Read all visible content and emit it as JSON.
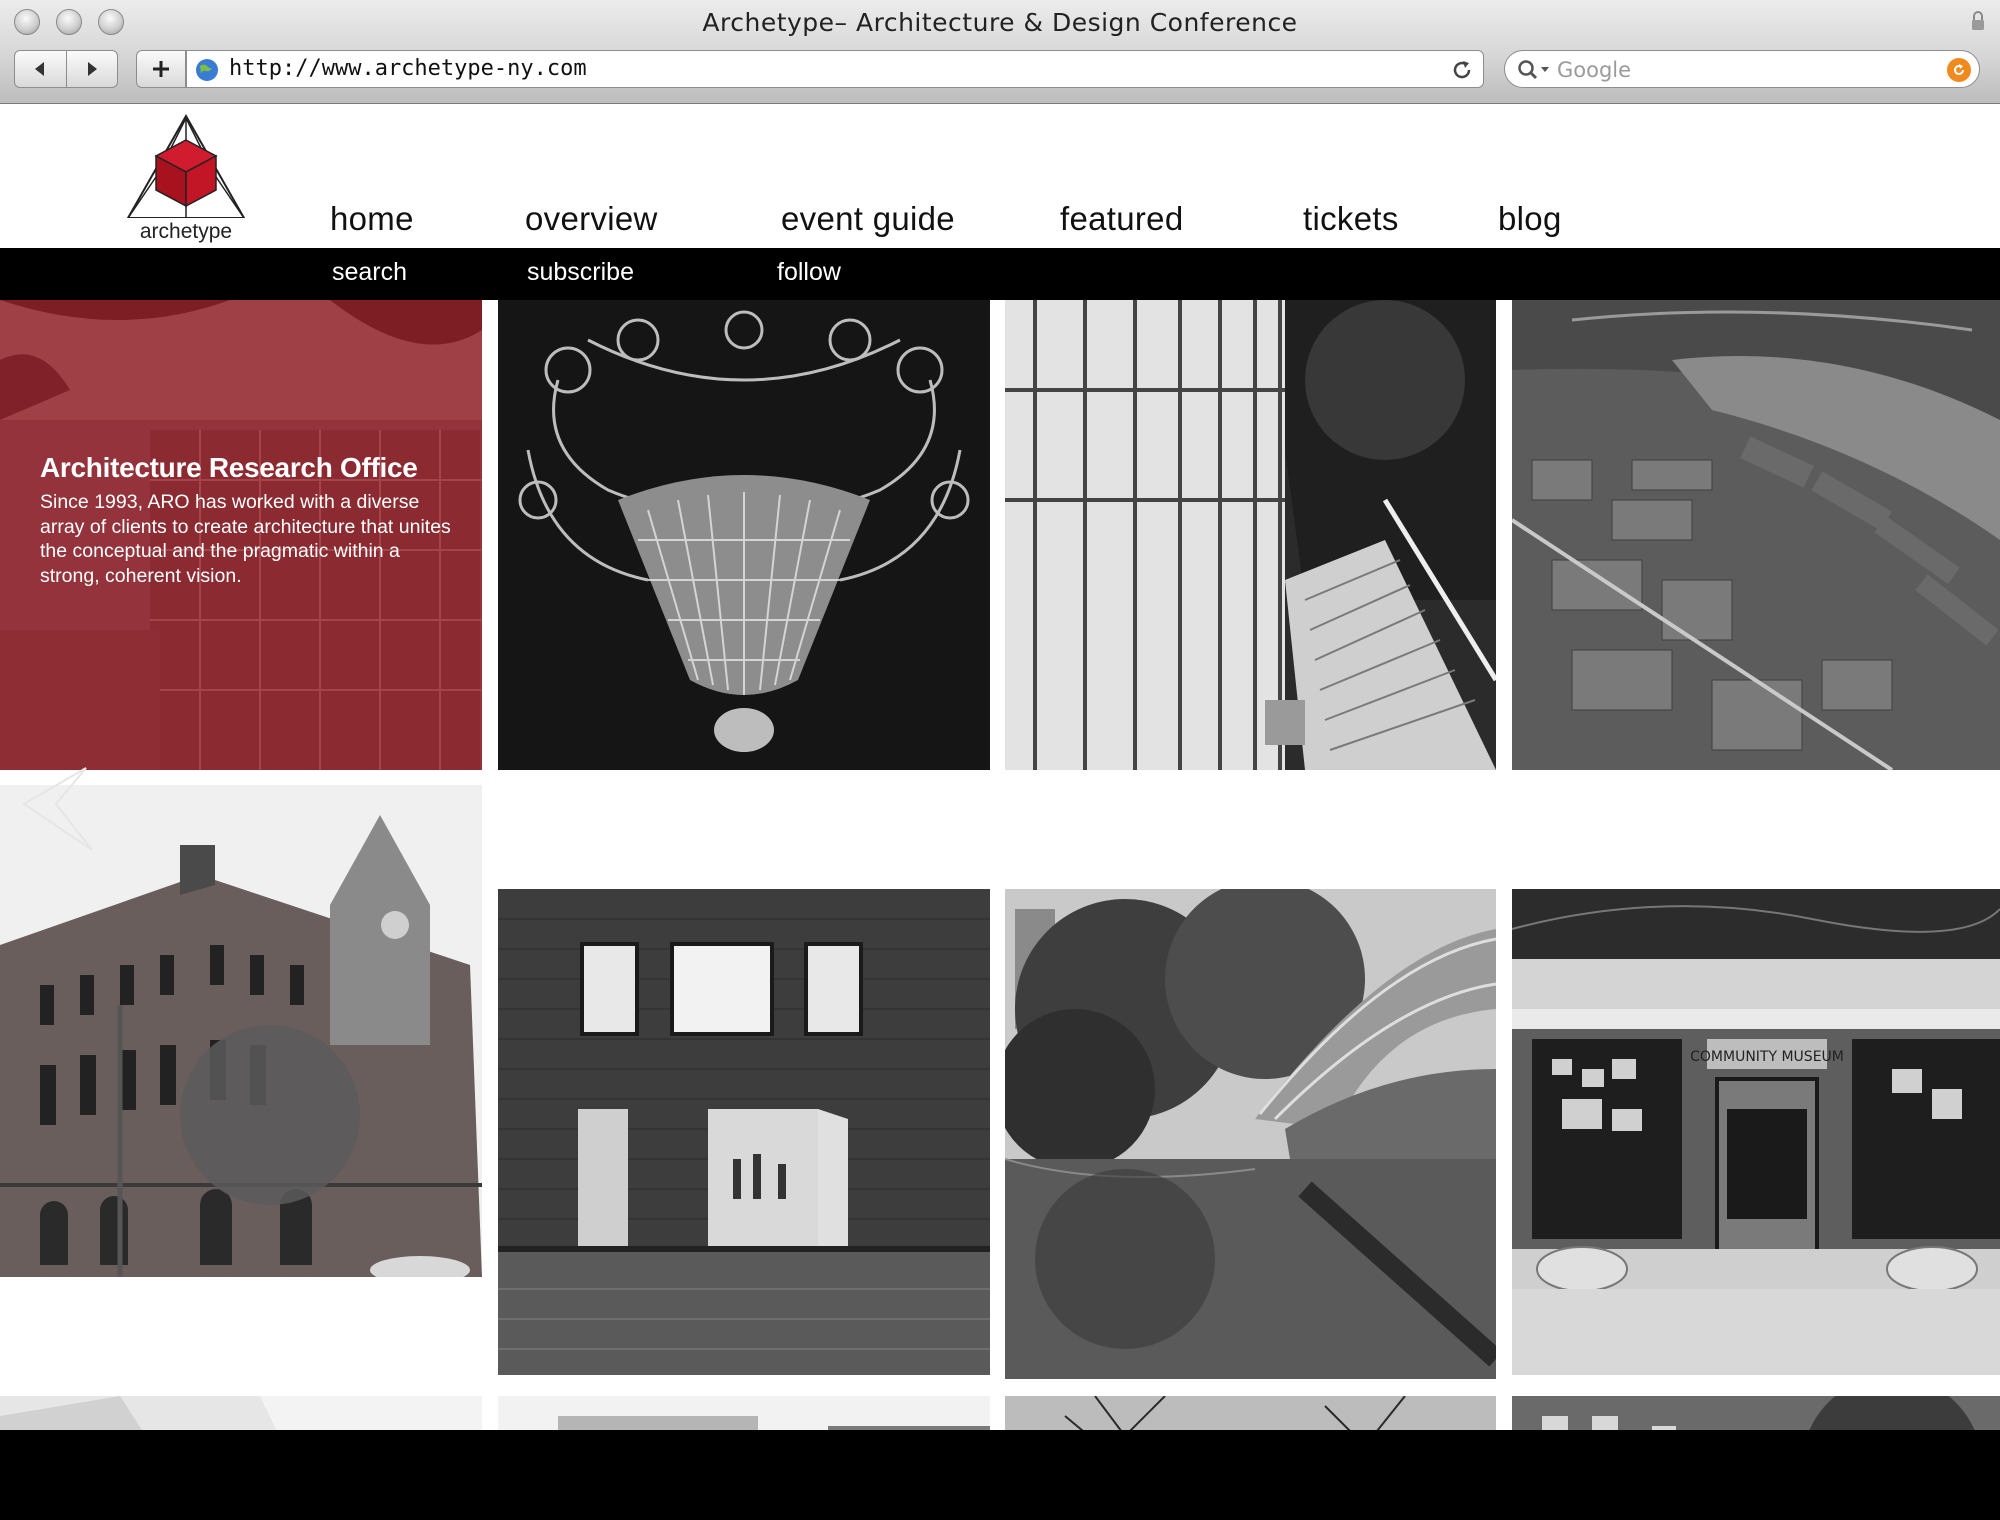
{
  "browser": {
    "window_title": "Archetype– Architecture & Design Conference",
    "url": "http://www.archetype-ny.com",
    "search_placeholder": "Google",
    "icons": [
      "close-window-icon",
      "minimize-window-icon",
      "zoom-window-icon",
      "back-icon",
      "forward-icon",
      "add-bookmark-icon",
      "globe-icon",
      "reload-icon",
      "search-icon",
      "search-go-icon",
      "lock-icon"
    ]
  },
  "site": {
    "logo_text": "archetype",
    "brand_color": "#b5162b",
    "main_nav": [
      "home",
      "overview",
      "event guide",
      "featured",
      "tickets",
      "blog"
    ],
    "sub_nav": [
      "search",
      "subscribe",
      "follow"
    ],
    "feature": {
      "heading": "Architecture Research Office",
      "body": "Since 1993, ARO has worked with a diverse array of clients to create architecture that unites the conceptual and the pragmatic within a strong, coherent vision."
    },
    "gallery": [
      {
        "subject": "Architecture Research Office building (red overlay)"
      },
      {
        "subject": "crystal chandelier"
      },
      {
        "subject": "glass curtain wall with exterior staircase"
      },
      {
        "subject": "aerial view of waterfront piers"
      },
      {
        "subject": "brick civic building with towers"
      },
      {
        "subject": "brick gallery with open doors and deck"
      },
      {
        "subject": "park bridge over reflecting lake"
      },
      {
        "subject": "City Reliquary Community Museum storefront"
      },
      {
        "subject": "modern white interior"
      },
      {
        "subject": "townhouse facades"
      },
      {
        "subject": "bare trees over rooftop"
      },
      {
        "subject": "ivy-covered brownstones"
      }
    ],
    "storefront_sign": "COMMUNITY MUSEUM"
  }
}
